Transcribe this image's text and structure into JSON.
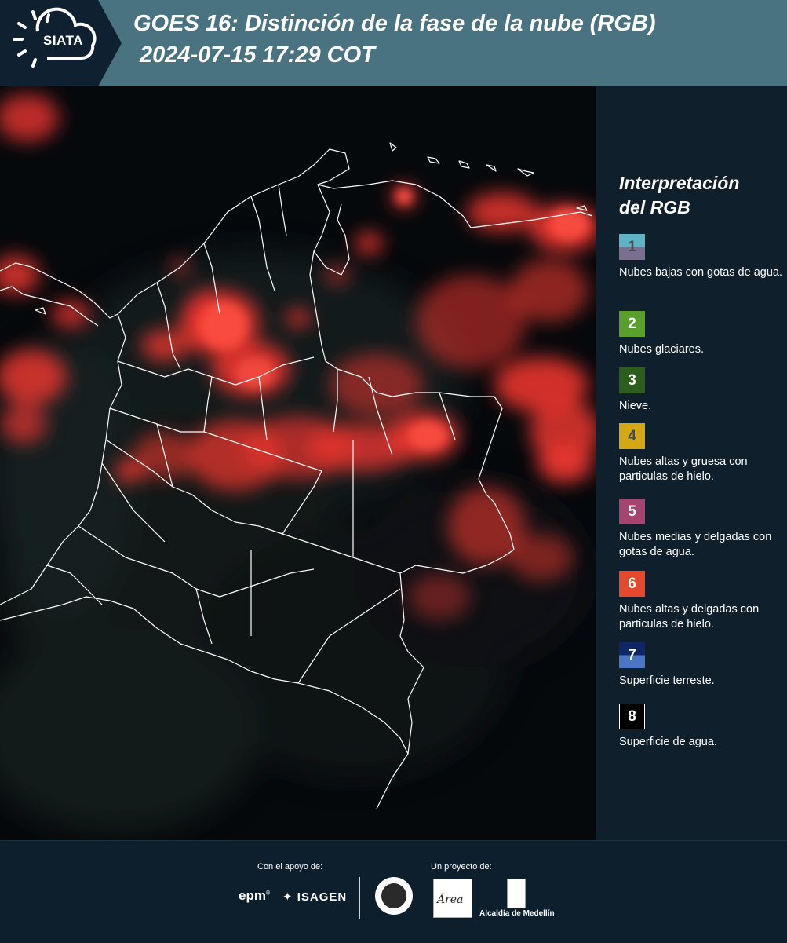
{
  "header": {
    "logo_text": "SIATA",
    "title_line1": "GOES 16: Distinción de la fase de la nube (RGB)",
    "title_line2": "2024-07-15 17:29 COT"
  },
  "legend": {
    "title_line1": "Interpretación",
    "title_line2": "del RGB",
    "items": [
      {
        "num": "1",
        "top_color": "#5fb3c4",
        "bottom_color": "#7a6f8c",
        "num_color": "#4a4a5a",
        "desc": "Nubes bajas con gotas de agua."
      },
      {
        "num": "2",
        "top_color": "#5a9e2c",
        "bottom_color": "#5a9e2c",
        "num_color": "#ffffff",
        "desc": "Nubes glaciares."
      },
      {
        "num": "3",
        "top_color": "#2d5e1e",
        "bottom_color": "#2d5e1e",
        "num_color": "#ffffff",
        "desc": "Nieve."
      },
      {
        "num": "4",
        "top_color": "#d4a714",
        "bottom_color": "#d4a714",
        "num_color": "#4a4a4a",
        "desc": "Nubes altas y gruesa con particulas de hielo."
      },
      {
        "num": "5",
        "top_color": "#a5456f",
        "bottom_color": "#a5456f",
        "num_color": "#ffffff",
        "desc": "Nubes medias y delgadas con gotas de agua."
      },
      {
        "num": "6",
        "top_color": "#e5482c",
        "bottom_color": "#e5482c",
        "num_color": "#ffffff",
        "desc": "Nubes altas y delgadas con particulas de hielo."
      },
      {
        "num": "7",
        "top_color": "#0f2766",
        "bottom_color": "#4c76c4",
        "num_color": "#ffffff",
        "desc": "Superficie terreste."
      },
      {
        "num": "8",
        "top_color": "#000000",
        "bottom_color": "#000000",
        "num_color": "#ffffff",
        "desc": "Superficie de agua."
      }
    ]
  },
  "footer": {
    "support_label": "Con el apoyo de:",
    "project_label": "Un proyecto de:",
    "epm": "epm",
    "isagen": "ISAGEN",
    "area_logo_text": "Área",
    "alcaldia": "Alcaldía de Medellín"
  }
}
